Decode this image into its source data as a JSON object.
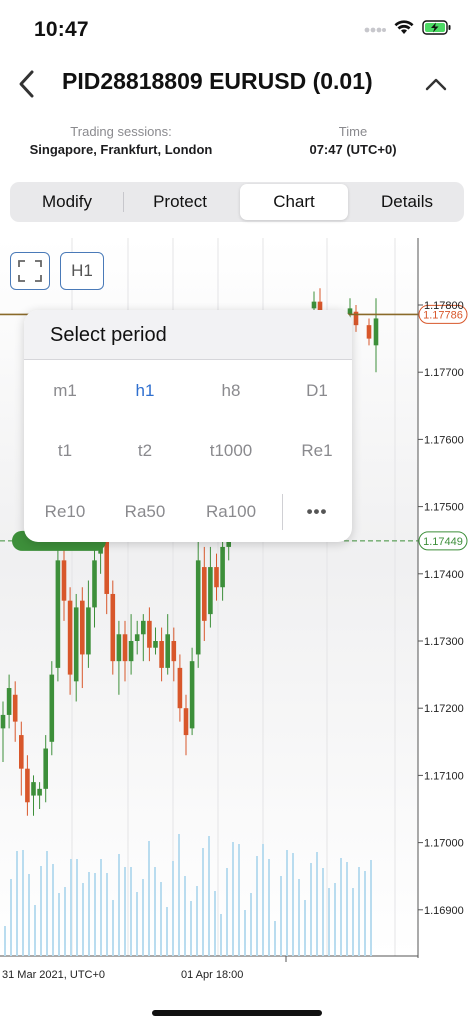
{
  "status_bar": {
    "time": "10:47"
  },
  "nav": {
    "title": "PID28818809 EURUSD (0.01)"
  },
  "info": {
    "sessions_label": "Trading sessions:",
    "sessions_value": "Singapore, Frankfurt, London",
    "time_label": "Time",
    "time_value": "07:47 (UTC+0)"
  },
  "tabs": [
    {
      "label": "Modify"
    },
    {
      "label": "Protect"
    },
    {
      "label": "Chart"
    },
    {
      "label": "Details"
    }
  ],
  "active_tab": "Chart",
  "chart_toolbar": {
    "period_button": "H1"
  },
  "period_popup": {
    "title": "Select period",
    "options": [
      "m1",
      "h1",
      "h8",
      "D1",
      "t1",
      "t2",
      "t1000",
      "Re1",
      "Re10",
      "Ra50",
      "Ra100"
    ],
    "selected": "h1",
    "more_label": "•••"
  },
  "chart_data": {
    "type": "candlestick",
    "title": "",
    "symbol": "EURUSD",
    "timeframe": "H1",
    "y_ticks": [
      "1.17800",
      "1.17700",
      "1.17600",
      "1.17500",
      "1.17400",
      "1.17300",
      "1.17200",
      "1.17100",
      "1.17000",
      "1.16900"
    ],
    "x_ticks": [
      "31 Mar 2021, UTC+0",
      "01 Apr 18:00"
    ],
    "ylim": [
      1.1685,
      1.1785
    ],
    "current_price_label": "1.17786",
    "current_price": 1.17786,
    "order_level_label": "1.17449",
    "order_level": 1.17449,
    "colors": {
      "up": "#3d8f3a",
      "down": "#d8572b",
      "current_line": "#8a6a2a",
      "order_line": "#3d8f3a",
      "volume": "#b9dcef",
      "accent": "#2f6fcf"
    }
  }
}
